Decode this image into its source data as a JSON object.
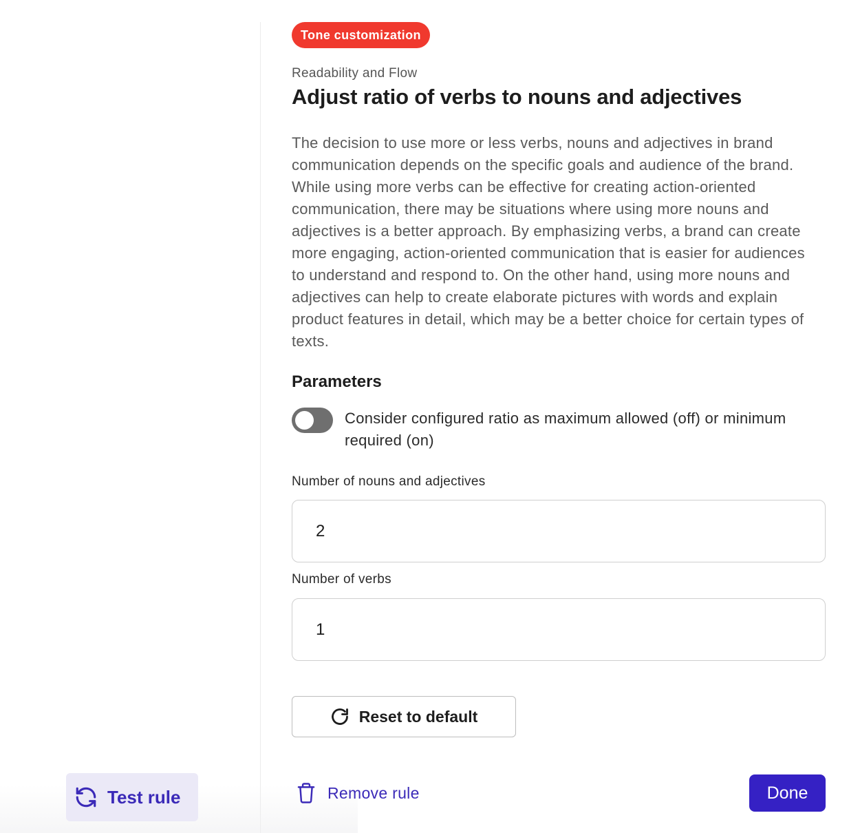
{
  "sidebar": {
    "test_rule_label": "Test rule"
  },
  "rule": {
    "badge": "Tone customization",
    "category": "Readability and Flow",
    "title": "Adjust ratio of verbs to nouns and adjectives",
    "description": "The decision to use more or less verbs, nouns and adjectives in brand communication depends on the specific goals and audience of the brand. While using more verbs can be effective for creating action-oriented communication, there may be situations where using more nouns and adjectives is a better approach. By emphasizing verbs, a brand can create more engaging, action-oriented communication that is easier for audiences to understand and respond to. On the other hand, using more nouns and adjectives can help to create elaborate pictures with words and explain product features in detail, which may be a better choice for certain types of texts."
  },
  "parameters": {
    "heading": "Parameters",
    "toggle_label": "Consider configured ratio as maximum allowed (off) or minimum required (on)",
    "toggle_on": false,
    "nouns_label": "Number of nouns and adjectives",
    "nouns_value": "2",
    "verbs_label": "Number of verbs",
    "verbs_value": "1"
  },
  "actions": {
    "reset_label": "Reset to default",
    "remove_label": "Remove rule",
    "done_label": "Done"
  },
  "colors": {
    "badge": "#f0392e",
    "accent": "#3521c4",
    "link": "#3b2ab8",
    "toggle_off": "#6f6f6f"
  },
  "icons": {
    "test_rule": "refresh-icon",
    "reset": "rotate-cw-icon",
    "remove": "trash-icon"
  }
}
